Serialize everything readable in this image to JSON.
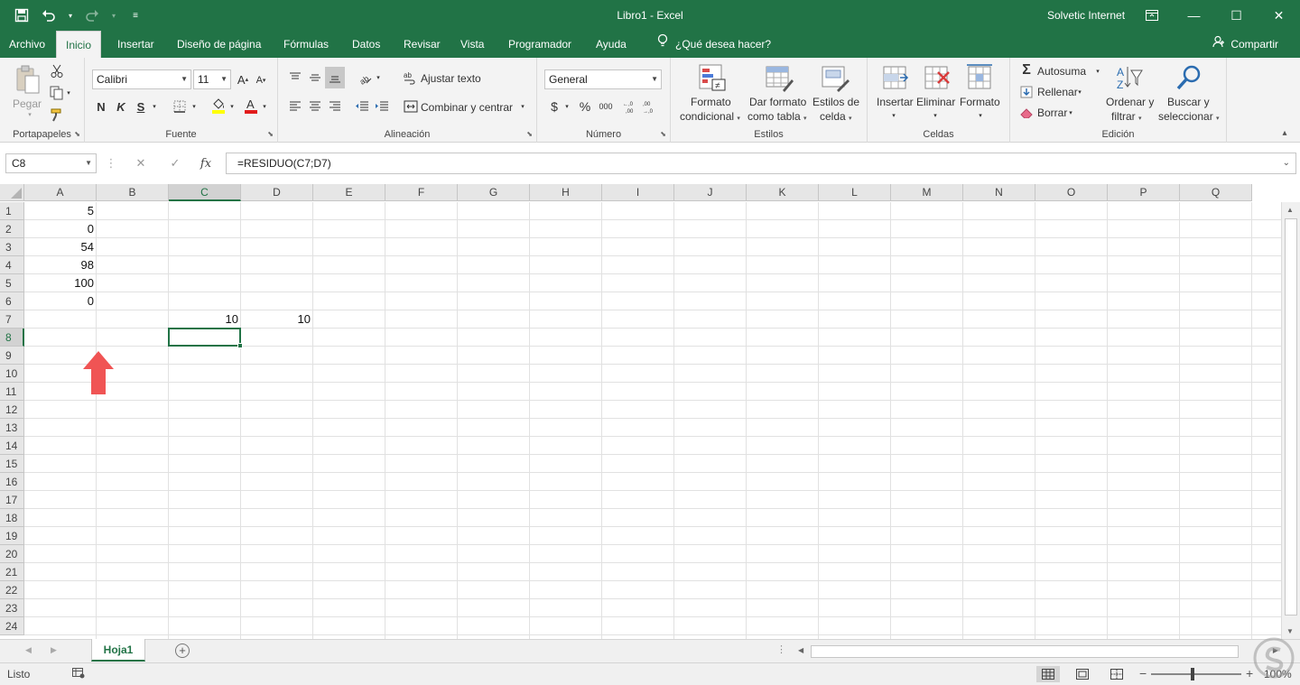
{
  "window": {
    "title": "Libro1  -  Excel",
    "user": "Solvetic Internet"
  },
  "tabs": [
    {
      "label": "Archivo"
    },
    {
      "label": "Inicio"
    },
    {
      "label": "Insertar"
    },
    {
      "label": "Diseño de página"
    },
    {
      "label": "Fórmulas"
    },
    {
      "label": "Datos"
    },
    {
      "label": "Revisar"
    },
    {
      "label": "Vista"
    },
    {
      "label": "Programador"
    },
    {
      "label": "Ayuda"
    },
    {
      "label": "¿Qué desea hacer?"
    }
  ],
  "share": "Compartir",
  "ribbon": {
    "clipboard": {
      "label": "Portapapeles",
      "paste": "Pegar"
    },
    "font": {
      "label": "Fuente",
      "name": "Calibri",
      "size": "11",
      "bold": "N",
      "italic": "K",
      "underline": "S"
    },
    "alignment": {
      "label": "Alineación",
      "wrap": "Ajustar texto",
      "merge": "Combinar y centrar"
    },
    "number": {
      "label": "Número",
      "format": "General",
      "currency": "$",
      "percent": "%",
      "thousands": "000"
    },
    "styles": {
      "label": "Estilos",
      "conditional": [
        "Formato",
        "condicional"
      ],
      "as_table": [
        "Dar formato",
        "como tabla"
      ],
      "cell_styles": [
        "Estilos de",
        "celda"
      ]
    },
    "cells": {
      "label": "Celdas",
      "insert": "Insertar",
      "delete": "Eliminar",
      "format": "Formato"
    },
    "editing": {
      "label": "Edición",
      "autosum": "Autosuma",
      "fill": "Rellenar",
      "clear": "Borrar",
      "sort": [
        "Ordenar y",
        "filtrar"
      ],
      "find": [
        "Buscar y",
        "seleccionar"
      ]
    }
  },
  "formula_bar": {
    "name_box": "C8",
    "formula": "=RESIDUO(C7;D7)"
  },
  "sheet": {
    "columns": [
      "A",
      "B",
      "C",
      "D",
      "E",
      "F",
      "G",
      "H",
      "I",
      "J",
      "K",
      "L",
      "M",
      "N",
      "O",
      "P",
      "Q"
    ],
    "rows": [
      "1",
      "2",
      "3",
      "4",
      "5",
      "6",
      "7",
      "8",
      "9",
      "10",
      "11",
      "12",
      "13",
      "14",
      "15",
      "16",
      "17",
      "18",
      "19",
      "20",
      "21",
      "22",
      "23",
      "24"
    ],
    "selected_cell": "C8",
    "cells": [
      {
        "ref": "A1",
        "value": "5"
      },
      {
        "ref": "A2",
        "value": "0"
      },
      {
        "ref": "A3",
        "value": "54"
      },
      {
        "ref": "A4",
        "value": "98"
      },
      {
        "ref": "A5",
        "value": "100"
      },
      {
        "ref": "A6",
        "value": "0"
      },
      {
        "ref": "C7",
        "value": "10"
      },
      {
        "ref": "D7",
        "value": "10"
      }
    ]
  },
  "sheet_tabs": [
    {
      "label": "Hoja1"
    }
  ],
  "status": {
    "text": "Listo",
    "zoom": "100%"
  },
  "colors": {
    "accent": "#217346",
    "arrow": "#f05454"
  }
}
